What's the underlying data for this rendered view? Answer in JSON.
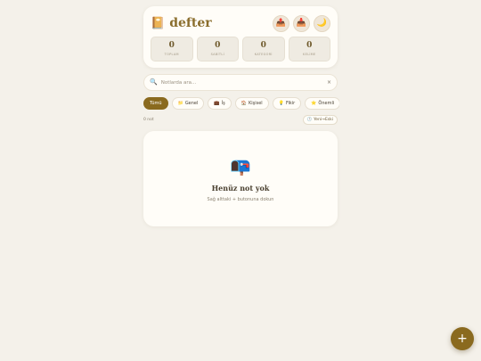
{
  "app": {
    "icon": "📔",
    "name": "defter"
  },
  "header_actions": [
    {
      "name": "export-icon",
      "glyph": "📤"
    },
    {
      "name": "import-icon",
      "glyph": "📥"
    },
    {
      "name": "dark-mode-icon",
      "glyph": "🌙"
    }
  ],
  "stats": [
    {
      "value": "0",
      "label": "TOPLAM"
    },
    {
      "value": "0",
      "label": "SABİTLİ"
    },
    {
      "value": "0",
      "label": "KATEGORİ"
    },
    {
      "value": "0",
      "label": "KELİME"
    }
  ],
  "search": {
    "icon": "🔍",
    "placeholder": "Notlarda ara...",
    "clear": "×"
  },
  "filters": [
    {
      "emoji": "",
      "label": "Tümü",
      "active": true
    },
    {
      "emoji": "📁",
      "label": "Genel"
    },
    {
      "emoji": "💼",
      "label": "İş"
    },
    {
      "emoji": "🏠",
      "label": "Kişisel"
    },
    {
      "emoji": "💡",
      "label": "Fikir"
    },
    {
      "emoji": "⭐",
      "label": "Önemli"
    }
  ],
  "list_meta": {
    "count": "0 not",
    "sort_icon": "🕓",
    "sort_label": "Yeni→Eski"
  },
  "empty_state": {
    "icon": "📭",
    "title": "Henüz not yok",
    "hint": "Sağ alttaki + butonuna dokun"
  },
  "fab": {
    "label": "+"
  },
  "colors": {
    "accent": "#8a6a1f",
    "background": "#f4f1ea",
    "card": "#fffdf8"
  }
}
